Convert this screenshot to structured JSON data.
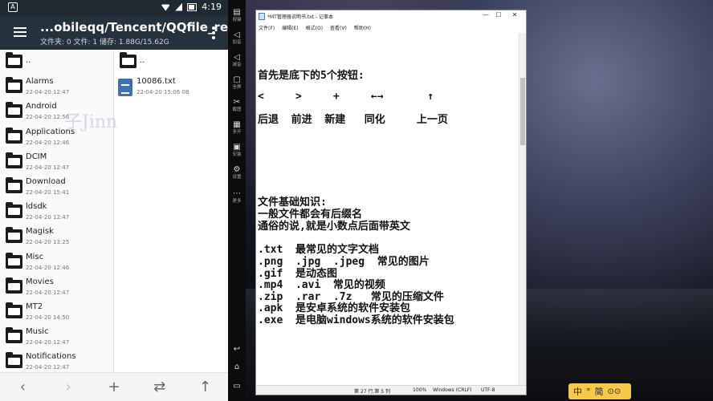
{
  "status_bar": {
    "time": "4:19",
    "left_icon": "A"
  },
  "file_manager": {
    "path": "...obileqq/Tencent/QQfile_rec/",
    "info": "文件夹: 0  文件: 1  储存: 1.88G/15.62G",
    "left_pane": [
      {
        "name": "..",
        "date": ""
      },
      {
        "name": "Alarms",
        "date": "22-04-20 12:47"
      },
      {
        "name": "Android",
        "date": "22-04-20 12:56"
      },
      {
        "name": "Applications",
        "date": "22-04-20 12:46"
      },
      {
        "name": "DCIM",
        "date": "22-04-20 12:47"
      },
      {
        "name": "Download",
        "date": "22-04-20 15:41"
      },
      {
        "name": "ldsdk",
        "date": "22-04-20 12:47"
      },
      {
        "name": "Magisk",
        "date": "22-04-20 13:25"
      },
      {
        "name": "Misc",
        "date": "22-04-20 12:46"
      },
      {
        "name": "Movies",
        "date": "22-04-20 12:47"
      },
      {
        "name": "MT2",
        "date": "22-04-20 14:50"
      },
      {
        "name": "Music",
        "date": "22-04-20 12:47"
      },
      {
        "name": "Notifications",
        "date": "22-04-20 12:47"
      }
    ],
    "right_pane": [
      {
        "name": "..",
        "date": ""
      },
      {
        "name": "10086.txt",
        "date": "22-04-20 15:06  0B"
      }
    ],
    "bottom_buttons": [
      "‹",
      "›",
      "+",
      "⇄",
      "↑"
    ]
  },
  "side_toolbar": [
    {
      "glyph": "▤",
      "label": "按键"
    },
    {
      "glyph": "◁",
      "label": "加音"
    },
    {
      "glyph": "◁",
      "label": "减音"
    },
    {
      "glyph": "▢",
      "label": "全屏"
    },
    {
      "glyph": "✂",
      "label": "截图"
    },
    {
      "glyph": "▦",
      "label": "多开"
    },
    {
      "glyph": "▣",
      "label": "安装"
    },
    {
      "glyph": "⚙",
      "label": "设置"
    },
    {
      "glyph": "⋯",
      "label": "更多"
    },
    {
      "glyph": "↩",
      "label": ""
    },
    {
      "glyph": "⌂",
      "label": ""
    },
    {
      "glyph": "▭",
      "label": ""
    }
  ],
  "notepad": {
    "title": "*MT管理器说明书.txt - 记事本",
    "window_controls": [
      "—",
      "☐",
      "✕"
    ],
    "menu": [
      "文件(F)",
      "编辑(E)",
      "格式(O)",
      "查看(V)",
      "帮助(H)"
    ],
    "lines": {
      "heading": "首先是底下的5个按钮:",
      "symbols": "<     >     +     ←→       ↑",
      "labels": "后退  前进  新建   同化     上一页",
      "basics": "文件基础知识:",
      "l1": "一般文件都会有后缀名",
      "l2": "通俗的说,就是小数点后面带英文",
      "e1": ".txt  最常见的文字文档",
      "e2": ".png  .jpg  .jpeg  常见的图片",
      "e3": ".gif  是动态图",
      "e4": ".mp4  .avi  常见的视频",
      "e5": ".zip  .rar  .7z   常见的压缩文件",
      "e6": ".apk  是安卓系统的软件安装包",
      "e7": ".exe  是电脑windows系统的软件安装包"
    },
    "status": {
      "position": "第 27 行,第 5 列",
      "zoom": "100%",
      "line_ending": "Windows (CRLF)",
      "encoding": "UTF-8"
    }
  },
  "watermark": "子Jinn",
  "ime": {
    "lang": "中",
    "dot": "°",
    "mode": "简",
    "face": "⊙⊙"
  }
}
